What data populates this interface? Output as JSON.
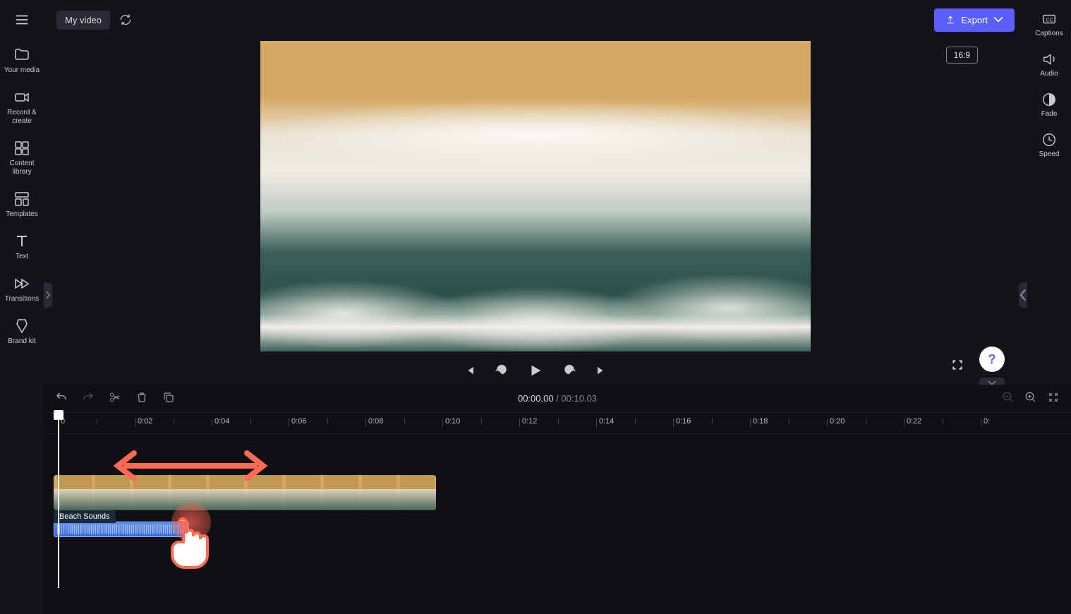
{
  "top": {
    "project_name": "My video",
    "export_label": "Export",
    "aspect_ratio": "16:9"
  },
  "left_sidebar": {
    "items": [
      {
        "label": "Your media"
      },
      {
        "label": "Record & create"
      },
      {
        "label": "Content library"
      },
      {
        "label": "Templates"
      },
      {
        "label": "Text"
      },
      {
        "label": "Transitions"
      },
      {
        "label": "Brand kit"
      }
    ]
  },
  "right_sidebar": {
    "items": [
      {
        "label": "Captions"
      },
      {
        "label": "Audio"
      },
      {
        "label": "Fade"
      },
      {
        "label": "Speed"
      }
    ]
  },
  "timeline": {
    "current_time": "00:00.00",
    "total_time": "00:10.03",
    "separator": " / ",
    "ruler_ticks": [
      "0",
      "0:02",
      "0:04",
      "0:06",
      "0:08",
      "0:10",
      "0:12",
      "0:14",
      "0:16",
      "0:18",
      "0:20",
      "0:22",
      "0:"
    ],
    "audio_clip_label": "Beach Sounds"
  },
  "help_label": "?"
}
